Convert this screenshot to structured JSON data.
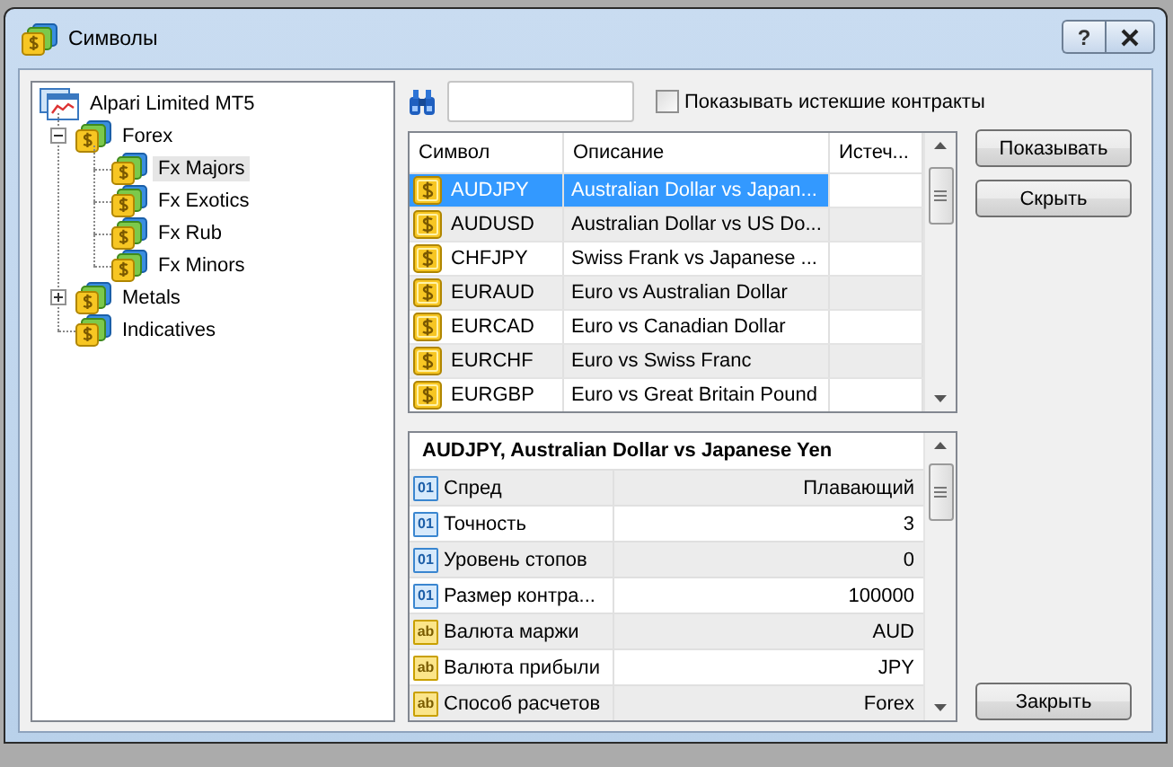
{
  "window": {
    "title": "Символы",
    "help_button": "?"
  },
  "tree": [
    {
      "label": "Alpari Limited MT5",
      "kind": "server",
      "selected": false,
      "children": [
        {
          "label": "Forex",
          "kind": "folder",
          "selected": false,
          "expanded": true,
          "children": [
            {
              "label": "Fx Majors",
              "kind": "folder",
              "selected": true
            },
            {
              "label": "Fx Exotics",
              "kind": "folder",
              "selected": false
            },
            {
              "label": "Fx Rub",
              "kind": "folder",
              "selected": false
            },
            {
              "label": "Fx Minors",
              "kind": "folder",
              "selected": false
            }
          ]
        },
        {
          "label": "Metals",
          "kind": "folder",
          "selected": false,
          "expanded": false
        },
        {
          "label": "Indicatives",
          "kind": "folder",
          "selected": false
        }
      ]
    }
  ],
  "filter": {
    "checkbox": {
      "label": "Показывать истекшие контракты",
      "checked": false
    }
  },
  "symbols": {
    "columns": [
      "Символ",
      "Описание",
      "Истеч..."
    ],
    "rows": [
      {
        "symbol": "AUDJPY",
        "description": "Australian Dollar vs Japan...",
        "selected": true
      },
      {
        "symbol": "AUDUSD",
        "description": "Australian Dollar vs US Do...",
        "selected": false
      },
      {
        "symbol": "CHFJPY",
        "description": "Swiss Frank vs Japanese ...",
        "selected": false
      },
      {
        "symbol": "EURAUD",
        "description": "Euro vs Australian Dollar",
        "selected": false
      },
      {
        "symbol": "EURCAD",
        "description": "Euro vs Canadian Dollar",
        "selected": false
      },
      {
        "symbol": "EURCHF",
        "description": "Euro vs Swiss Franc",
        "selected": false
      },
      {
        "symbol": "EURGBP",
        "description": "Euro vs Great Britain Pound",
        "selected": false
      }
    ]
  },
  "side_buttons": [
    "Показывать",
    "Скрыть"
  ],
  "properties": {
    "title": "AUDJPY, Australian Dollar vs Japanese Yen",
    "rows": [
      {
        "kind": "number",
        "icon": "01",
        "name": "Спред",
        "value": "Плавающий"
      },
      {
        "kind": "number",
        "icon": "01",
        "name": "Точность",
        "value": "3"
      },
      {
        "kind": "number",
        "icon": "01",
        "name": "Уровень стопов",
        "value": "0"
      },
      {
        "kind": "number",
        "icon": "01",
        "name": "Размер контра...",
        "value": "100000"
      },
      {
        "kind": "text",
        "icon": "ab",
        "name": "Валюта маржи",
        "value": "AUD"
      },
      {
        "kind": "text",
        "icon": "ab",
        "name": "Валюта прибыли",
        "value": "JPY"
      },
      {
        "kind": "text",
        "icon": "ab",
        "name": "Способ расчетов",
        "value": "Forex"
      }
    ]
  },
  "close_button": "Закрыть"
}
